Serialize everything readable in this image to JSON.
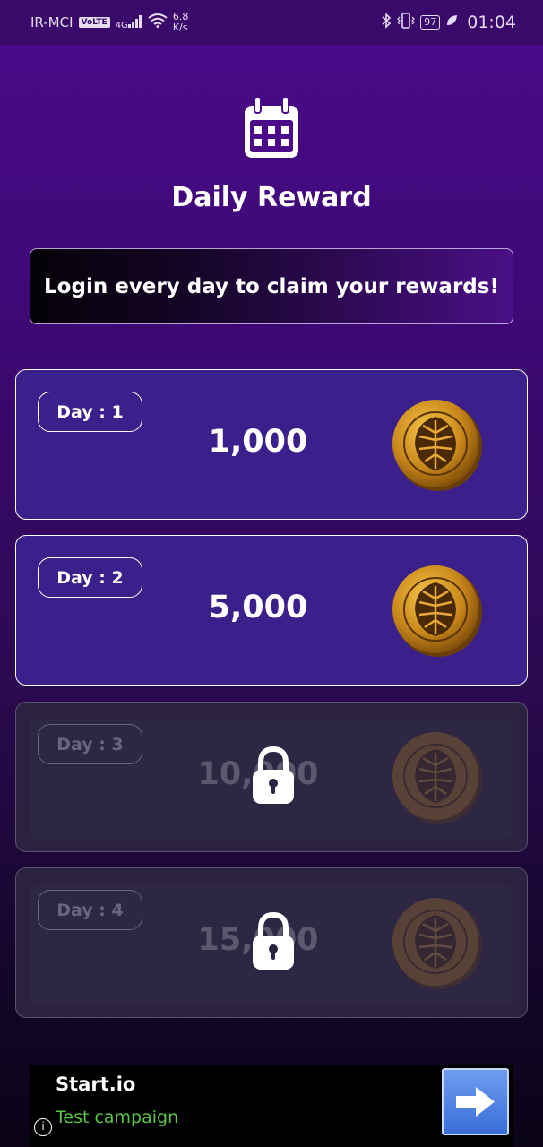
{
  "status_bar": {
    "carrier": "IR-MCI",
    "volte": "VoLTE",
    "network": "4G",
    "net_speed_value": "6.8",
    "net_speed_unit": "K/s",
    "battery": "97",
    "time": "01:04"
  },
  "header": {
    "icon": "calendar-icon",
    "title": "Daily Reward"
  },
  "banner": {
    "text": "Login every day to claim your rewards!"
  },
  "days": [
    {
      "label": "Day : 1",
      "amount": "1,000",
      "locked": false
    },
    {
      "label": "Day : 2",
      "amount": "5,000",
      "locked": false
    },
    {
      "label": "Day : 3",
      "amount": "10,000",
      "locked": true
    },
    {
      "label": "Day : 4",
      "amount": "15,000",
      "locked": true
    }
  ],
  "ad": {
    "title": "Start.io",
    "subtitle": "Test campaign",
    "info_icon": "info-icon",
    "button_icon": "arrow-right-icon"
  },
  "colors": {
    "card_active": "#3b1f8a",
    "card_locked": "#2a2240",
    "ad_subtitle": "#5cc24a",
    "ad_button": "#3a6fd8"
  }
}
